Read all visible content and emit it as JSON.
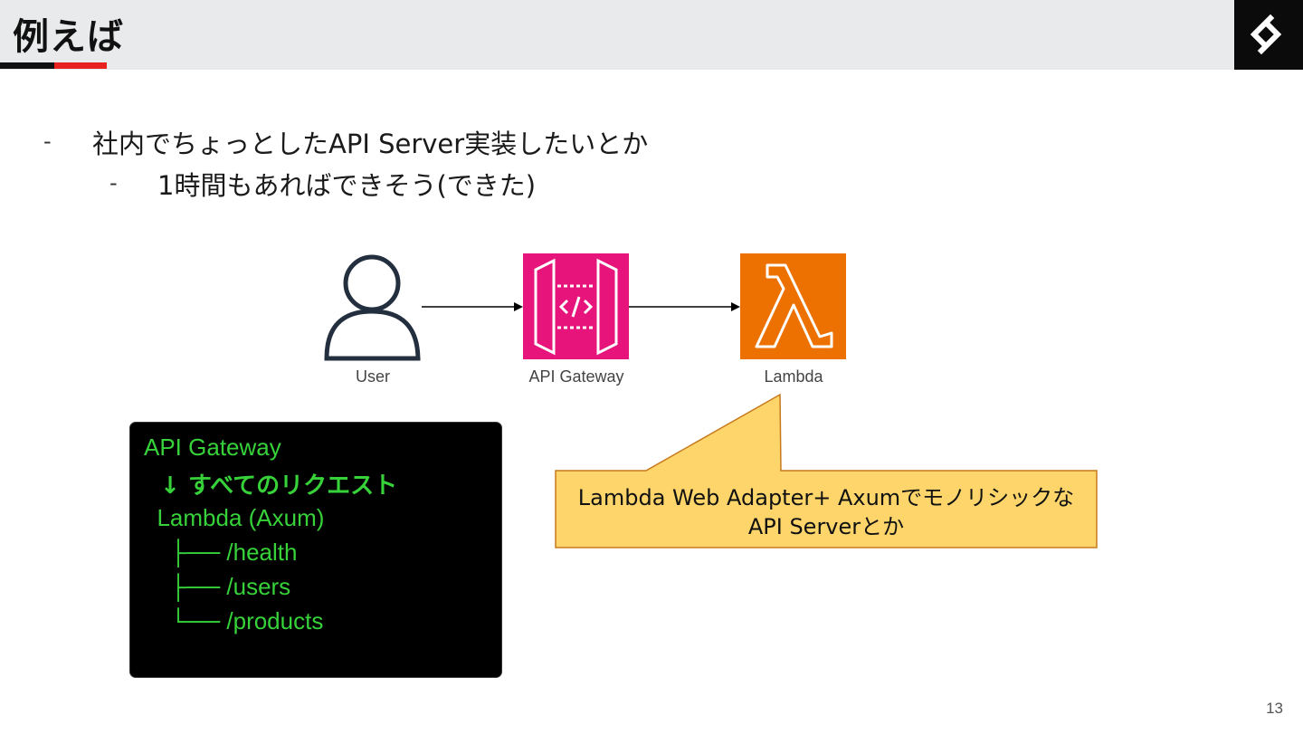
{
  "slide": {
    "title": "例えば",
    "page_number": "13"
  },
  "bullets": [
    {
      "marker": "-",
      "text": "社内でちょっとしたAPI Server実装したいとか"
    },
    {
      "marker": "-",
      "text": "1時間もあればできそう(できた)"
    }
  ],
  "diagram": {
    "nodes": [
      {
        "label": "User",
        "icon": "user-icon"
      },
      {
        "label": "API Gateway",
        "icon": "api-gateway-icon",
        "color": "#e7157b"
      },
      {
        "label": "Lambda",
        "icon": "lambda-icon",
        "color": "#ed7100"
      }
    ]
  },
  "terminal": {
    "lines": [
      "API Gateway",
      "  ↓ すべてのリクエスト",
      "  Lambda (Axum)",
      "    ├── /health",
      "    ├── /users",
      "    └── /products"
    ],
    "text_color": "#37d23a"
  },
  "callout": {
    "line1": "Lambda Web Adapter+ Axumでモノリシックな",
    "line2": "API Serverとか",
    "fill": "#fdd56b",
    "border": "#c77a1c"
  },
  "colors": {
    "header_bg": "#e8eaeb",
    "accent_red": "#e8201e"
  }
}
